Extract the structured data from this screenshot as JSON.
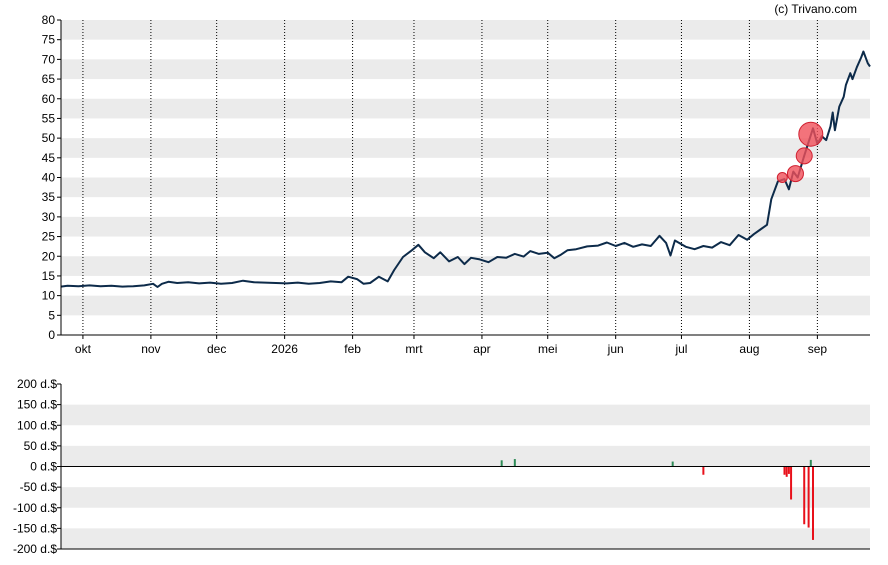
{
  "credit": "(c) Trivano.com",
  "colors": {
    "price_line": "#0d2b4a",
    "band": "#ebebeb",
    "axis": "#000000",
    "month_grid": "#000000",
    "marker_fill": "#f0505a",
    "marker_stroke": "#d02030",
    "buy_bar": "#2e8b57",
    "sell_bar": "#e8101a"
  },
  "chart_data": [
    {
      "type": "line",
      "ylim": [
        0,
        80
      ],
      "yticks": [
        "0",
        "5",
        "10",
        "15",
        "20",
        "25",
        "30",
        "35",
        "40",
        "45",
        "50",
        "55",
        "60",
        "65",
        "70",
        "75",
        "80"
      ],
      "grid": "alternating horizontal bands, dotted vertical lines at month starts",
      "x_axis": "dates, 2025-09-21 to 2026-09-16",
      "month_ticks": [
        {
          "date": "2025-10-01",
          "label": "okt"
        },
        {
          "date": "2025-11-01",
          "label": "nov"
        },
        {
          "date": "2025-12-01",
          "label": "dec"
        },
        {
          "date": "2026-01-01",
          "label": "2026"
        },
        {
          "date": "2026-02-01",
          "label": "feb"
        },
        {
          "date": "2026-03-01",
          "label": "mrt"
        },
        {
          "date": "2026-04-01",
          "label": "apr"
        },
        {
          "date": "2026-05-01",
          "label": "mei"
        },
        {
          "date": "2026-06-01",
          "label": "jun"
        },
        {
          "date": "2026-07-01",
          "label": "jul"
        },
        {
          "date": "2026-08-01",
          "label": "aug"
        },
        {
          "date": "2026-09-01",
          "label": "sep"
        }
      ],
      "series": [
        {
          "points": [
            [
              "2025-09-21",
              12.3
            ],
            [
              "2025-09-24",
              12.5
            ],
            [
              "2025-09-29",
              12.4
            ],
            [
              "2025-10-04",
              12.6
            ],
            [
              "2025-10-09",
              12.4
            ],
            [
              "2025-10-14",
              12.5
            ],
            [
              "2025-10-19",
              12.3
            ],
            [
              "2025-10-24",
              12.4
            ],
            [
              "2025-10-29",
              12.6
            ],
            [
              "2025-11-02",
              13.0
            ],
            [
              "2025-11-04",
              12.2
            ],
            [
              "2025-11-06",
              13.0
            ],
            [
              "2025-11-09",
              13.5
            ],
            [
              "2025-11-13",
              13.2
            ],
            [
              "2025-11-18",
              13.4
            ],
            [
              "2025-11-23",
              13.1
            ],
            [
              "2025-11-28",
              13.3
            ],
            [
              "2025-12-03",
              13.0
            ],
            [
              "2025-12-08",
              13.2
            ],
            [
              "2025-12-13",
              13.8
            ],
            [
              "2025-12-18",
              13.4
            ],
            [
              "2025-12-23",
              13.3
            ],
            [
              "2025-12-28",
              13.2
            ],
            [
              "2026-01-02",
              13.1
            ],
            [
              "2026-01-07",
              13.3
            ],
            [
              "2026-01-12",
              13.0
            ],
            [
              "2026-01-17",
              13.2
            ],
            [
              "2026-01-22",
              13.6
            ],
            [
              "2026-01-27",
              13.4
            ],
            [
              "2026-01-30",
              14.8
            ],
            [
              "2026-02-03",
              14.2
            ],
            [
              "2026-02-06",
              13.0
            ],
            [
              "2026-02-09",
              13.2
            ],
            [
              "2026-02-13",
              14.8
            ],
            [
              "2026-02-17",
              13.6
            ],
            [
              "2026-02-20",
              16.5
            ],
            [
              "2026-02-24",
              19.8
            ],
            [
              "2026-02-28",
              21.5
            ],
            [
              "2026-03-03",
              22.9
            ],
            [
              "2026-03-06",
              21.0
            ],
            [
              "2026-03-10",
              19.5
            ],
            [
              "2026-03-13",
              21.0
            ],
            [
              "2026-03-17",
              18.7
            ],
            [
              "2026-03-21",
              19.8
            ],
            [
              "2026-03-24",
              18.0
            ],
            [
              "2026-03-27",
              19.6
            ],
            [
              "2026-03-31",
              19.2
            ],
            [
              "2026-04-04",
              18.5
            ],
            [
              "2026-04-08",
              19.8
            ],
            [
              "2026-04-12",
              19.6
            ],
            [
              "2026-04-16",
              20.6
            ],
            [
              "2026-04-20",
              19.9
            ],
            [
              "2026-04-23",
              21.3
            ],
            [
              "2026-04-27",
              20.6
            ],
            [
              "2026-05-01",
              20.9
            ],
            [
              "2026-05-04",
              19.5
            ],
            [
              "2026-05-07",
              20.4
            ],
            [
              "2026-05-10",
              21.5
            ],
            [
              "2026-05-14",
              21.8
            ],
            [
              "2026-05-19",
              22.5
            ],
            [
              "2026-05-24",
              22.7
            ],
            [
              "2026-05-28",
              23.5
            ],
            [
              "2026-06-01",
              22.6
            ],
            [
              "2026-06-05",
              23.4
            ],
            [
              "2026-06-09",
              22.4
            ],
            [
              "2026-06-13",
              23.0
            ],
            [
              "2026-06-17",
              22.6
            ],
            [
              "2026-06-21",
              25.2
            ],
            [
              "2026-06-24",
              23.4
            ],
            [
              "2026-06-26",
              20.2
            ],
            [
              "2026-06-28",
              24.0
            ],
            [
              "2026-07-03",
              22.4
            ],
            [
              "2026-07-07",
              21.8
            ],
            [
              "2026-07-11",
              22.6
            ],
            [
              "2026-07-15",
              22.2
            ],
            [
              "2026-07-19",
              23.6
            ],
            [
              "2026-07-23",
              22.8
            ],
            [
              "2026-07-27",
              25.4
            ],
            [
              "2026-07-31",
              24.2
            ],
            [
              "2026-08-03",
              25.6
            ],
            [
              "2026-08-06",
              26.8
            ],
            [
              "2026-08-09",
              28.0
            ],
            [
              "2026-08-11",
              34.5
            ],
            [
              "2026-08-14",
              39.0
            ],
            [
              "2026-08-17",
              39.6
            ],
            [
              "2026-08-19",
              37.0
            ],
            [
              "2026-08-21",
              41.5
            ],
            [
              "2026-08-23",
              40.0
            ],
            [
              "2026-08-26",
              45.5
            ],
            [
              "2026-08-28",
              49.0
            ],
            [
              "2026-08-30",
              52.5
            ],
            [
              "2026-09-01",
              48.5
            ],
            [
              "2026-09-03",
              50.5
            ],
            [
              "2026-09-05",
              49.5
            ],
            [
              "2026-09-07",
              53.0
            ],
            [
              "2026-09-08",
              56.5
            ],
            [
              "2026-09-09",
              52.0
            ],
            [
              "2026-09-11",
              58.0
            ],
            [
              "2026-09-13",
              60.5
            ],
            [
              "2026-09-14",
              63.5
            ],
            [
              "2026-09-16",
              66.5
            ],
            [
              "2026-09-17",
              65.0
            ],
            [
              "2026-09-19",
              68.0
            ],
            [
              "2026-09-21",
              70.5
            ],
            [
              "2026-09-22",
              72.0
            ],
            [
              "2026-09-24",
              69.0
            ],
            [
              "2026-09-25",
              68.2
            ]
          ]
        }
      ],
      "markers": [
        {
          "date": "2026-08-16",
          "value": 40.0,
          "size": "small"
        },
        {
          "date": "2026-08-22",
          "value": 41.0,
          "size": "medium"
        },
        {
          "date": "2026-08-26",
          "value": 45.5,
          "size": "medium"
        },
        {
          "date": "2026-08-29",
          "value": 51.0,
          "size": "large"
        }
      ]
    },
    {
      "type": "bar",
      "ylim": [
        -200,
        200
      ],
      "yticks": [
        "200 d.$",
        "150 d.$",
        "100 d.$",
        "50 d.$",
        "0 d.$",
        "-50 d.$",
        "-100 d.$",
        "-150 d.$",
        "-200 d.$"
      ],
      "grid": "alternating horizontal bands",
      "bars": [
        {
          "date": "2026-04-10",
          "value": 15
        },
        {
          "date": "2026-04-16",
          "value": 18
        },
        {
          "date": "2026-06-27",
          "value": 12
        },
        {
          "date": "2026-07-11",
          "value": -20
        },
        {
          "date": "2026-08-17",
          "value": -20
        },
        {
          "date": "2026-08-18",
          "value": -25
        },
        {
          "date": "2026-08-19",
          "value": -18
        },
        {
          "date": "2026-08-20",
          "value": -80
        },
        {
          "date": "2026-08-26",
          "value": -140
        },
        {
          "date": "2026-08-28",
          "value": -148
        },
        {
          "date": "2026-08-29",
          "value": 16
        },
        {
          "date": "2026-08-30",
          "value": -178
        }
      ]
    }
  ]
}
